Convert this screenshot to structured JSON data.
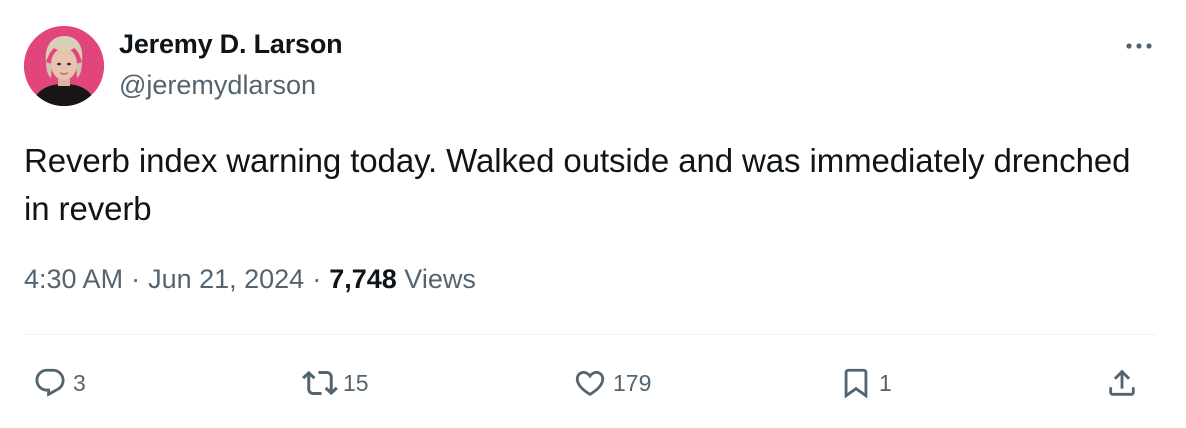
{
  "author": {
    "name": "Jeremy D. Larson",
    "handle": "@jeremydlarson",
    "avatar_bg": "#e2447c"
  },
  "tweet": {
    "text": "Reverb index warning today. Walked outside and was immediately drenched in reverb",
    "time": "4:30 AM",
    "date": "Jun 21, 2024",
    "separator": "·",
    "views_count": "7,748",
    "views_label": "Views"
  },
  "actions": {
    "reply": {
      "icon": "reply-icon",
      "count": "3"
    },
    "repost": {
      "icon": "repost-icon",
      "count": "15"
    },
    "like": {
      "icon": "heart-icon",
      "count": "179"
    },
    "bookmark": {
      "icon": "bookmark-icon",
      "count": "1"
    },
    "share": {
      "icon": "share-icon"
    }
  },
  "colors": {
    "text_primary": "#0f1419",
    "text_secondary": "#536471",
    "divider": "#eff3f4"
  }
}
